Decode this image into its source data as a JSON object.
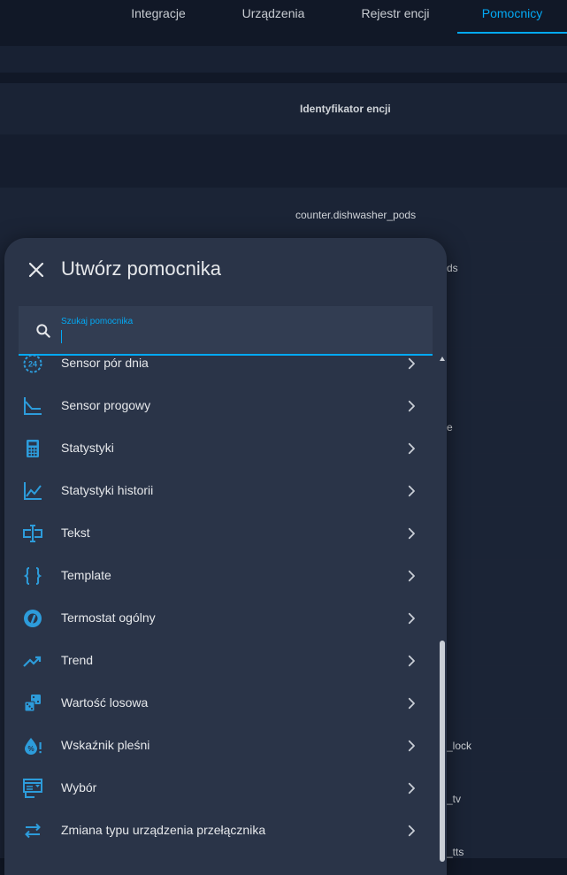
{
  "tabs": [
    "Integracje",
    "Urządzenia",
    "Rejestr encji",
    "Pomocnicy"
  ],
  "active_tab": "Pomocnicy",
  "background": {
    "column_header": "Identyfikator encji",
    "first_row": "counter.dishwasher_pods",
    "partial_rows": [
      "ds",
      "e",
      "_lock",
      "_tv",
      "_tts"
    ]
  },
  "dialog": {
    "title": "Utwórz pomocnika",
    "search": {
      "label": "Szukaj pomocnika",
      "value": ""
    },
    "items": [
      {
        "label": "Sensor pór dnia",
        "icon": "clock-24-icon"
      },
      {
        "label": "Sensor progowy",
        "icon": "threshold-icon"
      },
      {
        "label": "Statystyki",
        "icon": "calculator-icon"
      },
      {
        "label": "Statystyki historii",
        "icon": "chart-line-icon"
      },
      {
        "label": "Tekst",
        "icon": "text-field-icon"
      },
      {
        "label": "Template",
        "icon": "code-braces-icon"
      },
      {
        "label": "Termostat ogólny",
        "icon": "thermostat-icon"
      },
      {
        "label": "Trend",
        "icon": "trending-up-icon"
      },
      {
        "label": "Wartość losowa",
        "icon": "dice-icon"
      },
      {
        "label": "Wskaźnik pleśni",
        "icon": "water-percent-alert-icon"
      },
      {
        "label": "Wybór",
        "icon": "form-dropdown-icon"
      },
      {
        "label": "Zmiana typu urządzenia przełącznika",
        "icon": "swap-horizontal-icon"
      }
    ]
  },
  "colors": {
    "accent": "#03a9f4",
    "dialog_bg": "#2a3448",
    "page_bg": "#111827"
  }
}
